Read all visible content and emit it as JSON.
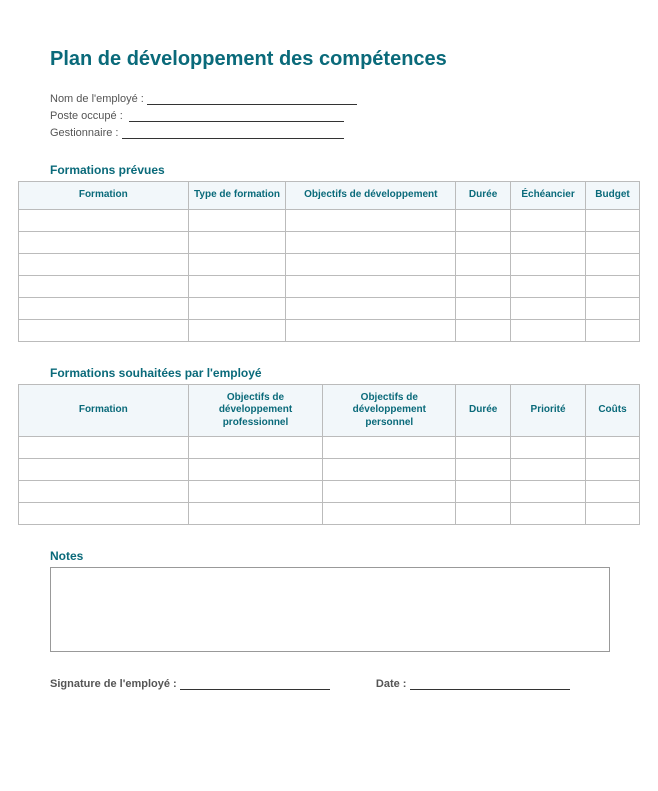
{
  "title": "Plan de développement des compétences",
  "fields": {
    "employee_name_label": "Nom de l'employé :",
    "position_label": "Poste occupé :",
    "manager_label": "Gestionnaire :"
  },
  "section1": {
    "heading": "Formations prévues",
    "headers": [
      "Formation",
      "Type de formation",
      "Objectifs de développement",
      "Durée",
      "Échéancier",
      "Budget"
    ],
    "rows": 6
  },
  "section2": {
    "heading": "Formations souhaitées par l'employé",
    "headers": [
      "Formation",
      "Objectifs de développement professionnel",
      "Objectifs de développement personnel",
      "Durée",
      "Priorité",
      "Coûts"
    ],
    "rows": 4
  },
  "notes_heading": "Notes",
  "footer": {
    "signature_label": "Signature de l'employé :",
    "date_label": "Date :"
  }
}
